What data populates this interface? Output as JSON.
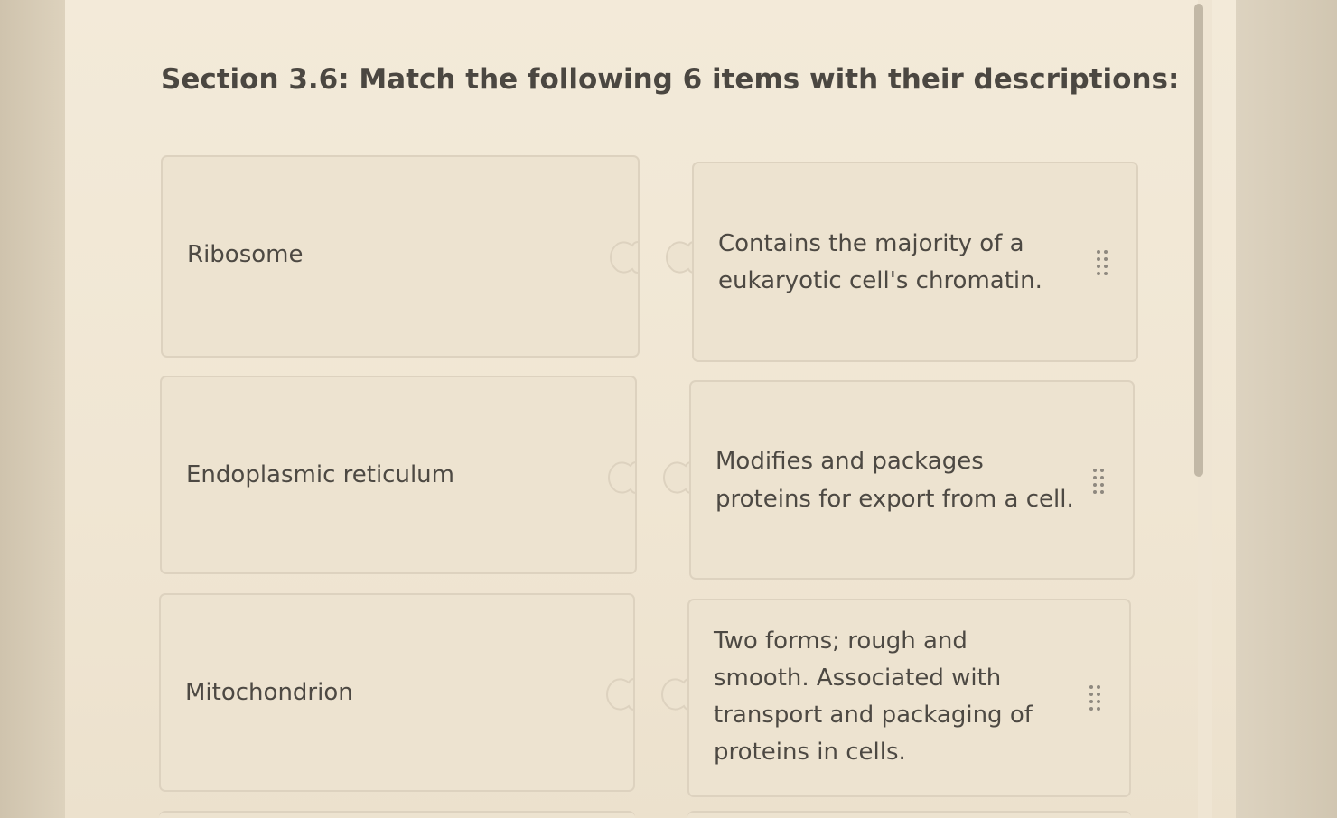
{
  "question": {
    "title": "Section 3.6: Match the following 6 items with their descriptions:"
  },
  "items": [
    {
      "label": "Ribosome"
    },
    {
      "label": "Endoplasmic reticulum"
    },
    {
      "label": "Mitochondrion"
    }
  ],
  "descriptions": [
    {
      "lines": [
        "Contains the majority of a",
        "eukaryotic cell's chromatin."
      ]
    },
    {
      "lines": [
        "Modifies and packages",
        "proteins for export from a cell."
      ]
    },
    {
      "lines": [
        "Two forms; rough and",
        "smooth.  Associated with",
        "transport and packaging of",
        "proteins in cells."
      ]
    }
  ],
  "icons": {
    "drag_handle": "grip-vertical-icon",
    "connector": "puzzle-connector-icon"
  }
}
